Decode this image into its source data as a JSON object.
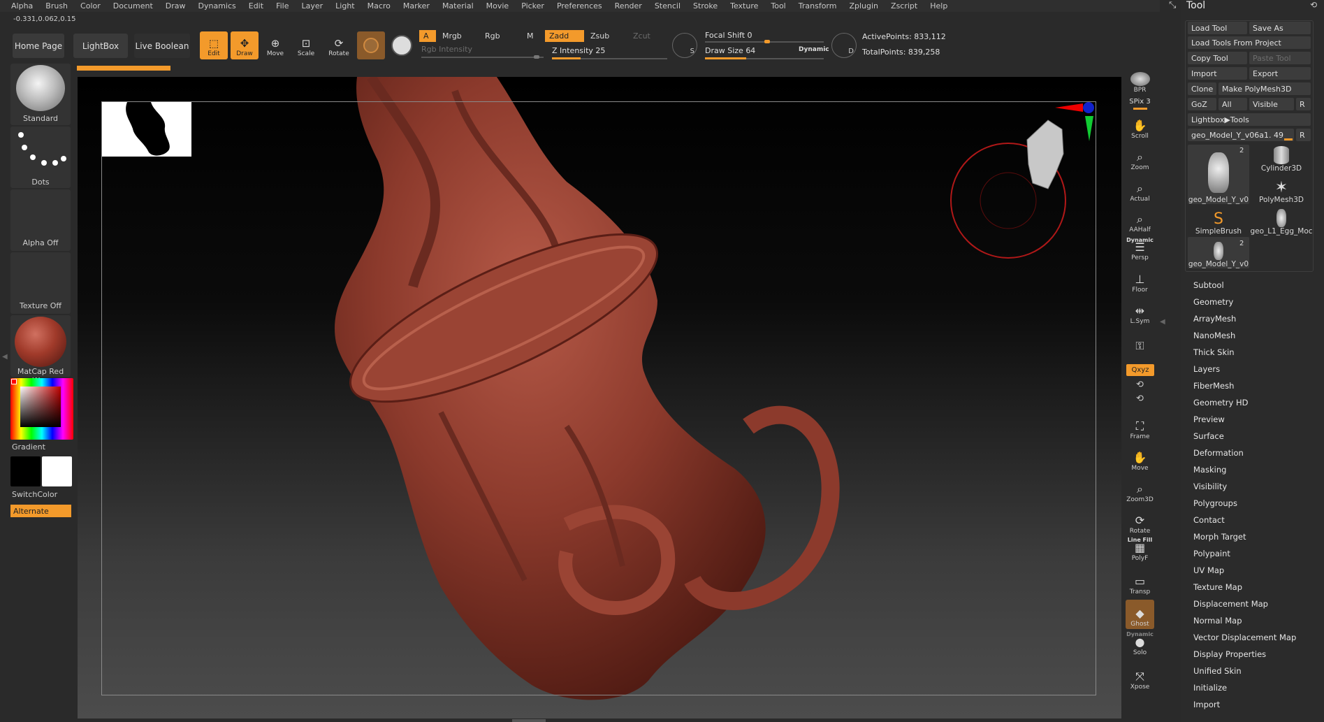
{
  "menu": [
    "Alpha",
    "Brush",
    "Color",
    "Document",
    "Draw",
    "Dynamics",
    "Edit",
    "File",
    "Layer",
    "Light",
    "Macro",
    "Marker",
    "Material",
    "Movie",
    "Picker",
    "Preferences",
    "Render",
    "Stencil",
    "Stroke",
    "Texture",
    "Tool",
    "Transform",
    "Zplugin",
    "Zscript",
    "Help"
  ],
  "coords": "-0.331,0.062,0.15",
  "nav": {
    "home": "Home Page",
    "lightbox": "LightBox",
    "live_boolean": "Live Boolean"
  },
  "modes": {
    "edit": "Edit",
    "draw": "Draw",
    "move": "Move",
    "scale": "Scale",
    "rotate": "Rotate"
  },
  "channels": {
    "a": "A",
    "mrgb": "Mrgb",
    "rgb": "Rgb",
    "m": "M",
    "zadd": "Zadd",
    "zsub": "Zsub",
    "zcut": "Zcut",
    "rgb_intensity": "Rgb Intensity"
  },
  "z_intensity": {
    "label": "Z Intensity",
    "value": "25",
    "level": 0.25
  },
  "focal_shift": {
    "label": "Focal Shift",
    "value": "0",
    "level": 0.5
  },
  "draw_size": {
    "label": "Draw Size",
    "value": "64",
    "level": 0.35,
    "dynamic": "Dynamic"
  },
  "stats": {
    "active": "ActivePoints: 833,112",
    "total": "TotalPoints: 839,258"
  },
  "left": {
    "brush": "Standard",
    "stroke": "Dots",
    "alpha": "Alpha Off",
    "texture": "Texture Off",
    "material": "MatCap Red Wax",
    "gradient": "Gradient",
    "switchcolor": "SwitchColor",
    "alternate": "Alternate"
  },
  "right_toolbar": {
    "bpr": "BPR",
    "spix": "SPix 3",
    "scroll": "Scroll",
    "zoom": "Zoom",
    "actual": "Actual",
    "aahalf": "AAHalf",
    "dynamic": "Dynamic",
    "persp": "Persp",
    "floor": "Floor",
    "lsym": "L.Sym",
    "xyz": "Qxyz",
    "frame": "Frame",
    "move": "Move",
    "zoom3d": "Zoom3D",
    "rotate": "Rotate",
    "linefill": "Line Fill",
    "polyf": "PolyF",
    "transp": "Transp",
    "ghost": "Ghost",
    "dynamic2": "Dynamic",
    "solo": "Solo",
    "xpose": "Xpose"
  },
  "tool": {
    "title": "Tool",
    "load_tool": "Load Tool",
    "save_as": "Save As",
    "load_from_project": "Load Tools From Project",
    "copy_tool": "Copy Tool",
    "paste_tool": "Paste Tool",
    "import": "Import",
    "export": "Export",
    "clone": "Clone",
    "make_polymesh": "Make PolyMesh3D",
    "goz": "GoZ",
    "all": "All",
    "visible": "Visible",
    "r": "R",
    "lightbox_tools": "Lightbox▶Tools",
    "current_tool": "geo_Model_Y_v06a1. 49",
    "current_r": "R",
    "thumbs": [
      {
        "label": "geo_Model_Y_v0",
        "count": "2"
      },
      {
        "label": "Cylinder3D",
        "count": ""
      },
      {
        "label": "geo_Model_Y_v0",
        "count": ""
      },
      {
        "label": "PolyMesh3D",
        "count": ""
      },
      {
        "label": "SimpleBrush",
        "count": ""
      },
      {
        "label": "geo_L1_Egg_Moc",
        "count": ""
      },
      {
        "label": "geo_Model_Y_v0",
        "count": "2"
      }
    ],
    "menus": [
      "Subtool",
      "Geometry",
      "ArrayMesh",
      "NanoMesh",
      "Thick Skin",
      "Layers",
      "FiberMesh",
      "Geometry HD",
      "Preview",
      "Surface",
      "Deformation",
      "Masking",
      "Visibility",
      "Polygroups",
      "Contact",
      "Morph Target",
      "Polypaint",
      "UV Map",
      "Texture Map",
      "Displacement Map",
      "Normal Map",
      "Vector Displacement Map",
      "Display Properties",
      "Unified Skin",
      "Initialize",
      "Import"
    ]
  },
  "colors": {
    "accent": "#f39a2b",
    "model": "#8c3a2c",
    "ring": "#b01818"
  }
}
